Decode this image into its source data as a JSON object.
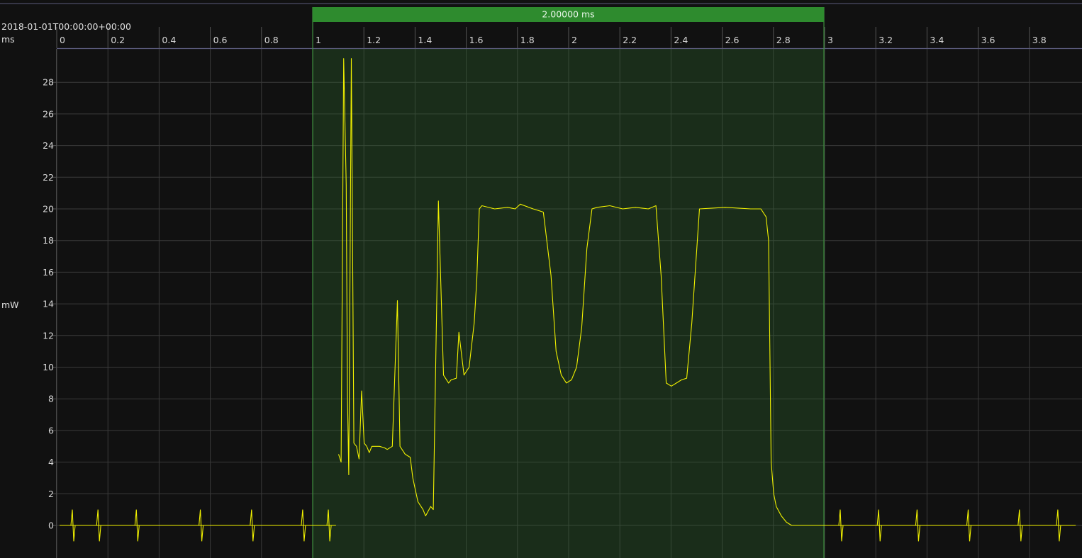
{
  "chart_data": {
    "type": "line",
    "timestamp": "2018-01-01T00:00:00+00:00",
    "xlabel": "ms",
    "ylabel": "mW",
    "xlim": [
      -0.22,
      3.97
    ],
    "ylim": [
      -1.9,
      30.0
    ],
    "x_ticks": [
      0,
      0.2,
      0.4,
      0.6,
      0.8,
      1,
      1.2,
      1.4,
      1.6,
      1.8,
      2,
      2.2,
      2.4,
      2.6,
      2.8,
      3,
      3.2,
      3.4,
      3.6,
      3.8
    ],
    "x_tick_labels": [
      "0",
      "0.2",
      "0.4",
      "0.6",
      "0.8",
      "1",
      "1.2",
      "1.4",
      "1.6",
      "1.8",
      "2",
      "2.2",
      "2.4",
      "2.6",
      "2.8",
      "3",
      "3.2",
      "3.4",
      "3.6",
      "3.8"
    ],
    "y_ticks": [
      0,
      2,
      4,
      6,
      8,
      10,
      12,
      14,
      16,
      18,
      20,
      22,
      24,
      26,
      28
    ],
    "y_tick_labels": [
      "0",
      "2",
      "4",
      "6",
      "8",
      "10",
      "12",
      "14",
      "16",
      "18",
      "20",
      "22",
      "24",
      "26",
      "28"
    ],
    "grid": true,
    "selection": {
      "start": 1.0,
      "end": 3.0,
      "label": "2.00000 ms",
      "color": "#2e8b2e"
    },
    "series": [
      {
        "color": "#f2f200",
        "segments": [
          {
            "x": [
              0.0,
              0.25,
              0.45,
              0.65,
              0.8,
              0.92,
              0.98,
              1.03,
              1.08
            ],
            "y": [
              0,
              0,
              0,
              0,
              0,
              0,
              0,
              0,
              0
            ]
          },
          {
            "x": [
              1.09,
              1.1,
              1.11,
              1.12,
              1.125,
              1.13,
              1.14,
              1.15,
              1.16,
              1.17,
              1.18,
              1.19,
              1.2,
              1.21,
              1.22,
              1.23,
              1.25,
              1.27,
              1.28,
              1.3,
              1.32,
              1.33,
              1.35,
              1.37,
              1.38,
              1.4,
              1.42,
              1.43,
              1.45,
              1.46,
              1.48,
              1.49,
              1.5,
              1.52,
              1.53,
              1.55,
              1.56,
              1.58,
              1.6,
              1.62,
              1.63,
              1.64,
              1.65,
              1.7,
              1.75,
              1.78,
              1.8,
              1.85,
              1.89
            ],
            "y": [
              4.5,
              4.0,
              29.5,
              21.5,
              8.0,
              3.2,
              29.5,
              5.2,
              5.0,
              4.2,
              8.5,
              5.2,
              5.0,
              4.6,
              5.0,
              5.0,
              5.0,
              4.9,
              4.8,
              5.0,
              14.2,
              5.0,
              4.5,
              4.3,
              3.0,
              1.5,
              1.0,
              0.6,
              1.2,
              1.0,
              20.5,
              15.0,
              9.5,
              9.0,
              9.2,
              9.3,
              12.2,
              9.5,
              10.0,
              12.8,
              15.5,
              20.0,
              20.2,
              20.0,
              20.1,
              20.0,
              20.3,
              20.0,
              19.8
            ]
          },
          {
            "x": [
              1.89,
              1.92,
              1.94,
              1.96,
              1.98,
              2.0,
              2.02,
              2.04,
              2.06,
              2.08,
              2.1,
              2.15,
              2.2,
              2.25,
              2.3,
              2.33,
              2.35,
              2.37,
              2.39,
              2.41,
              2.43,
              2.45,
              2.47,
              2.5,
              2.6,
              2.7,
              2.74,
              2.76,
              2.77,
              2.78,
              2.79,
              2.8,
              2.82,
              2.84,
              2.86,
              2.9,
              3.0,
              3.3,
              3.6,
              3.97
            ],
            "y": [
              19.8,
              15.8,
              11.0,
              9.5,
              9.0,
              9.2,
              10.0,
              12.5,
              17.5,
              20.0,
              20.1,
              20.2,
              20.0,
              20.1,
              20.0,
              20.2,
              15.8,
              9.0,
              8.8,
              9.0,
              9.2,
              9.3,
              12.8,
              20.0,
              20.1,
              20.0,
              20.0,
              19.5,
              18.0,
              4.0,
              2.0,
              1.2,
              0.6,
              0.2,
              0.0,
              0.0,
              0.0,
              0.0,
              0.0,
              0.0
            ]
          }
        ]
      }
    ],
    "spikes": [
      {
        "x": [
          0.05,
          0.15,
          0.3,
          0.55,
          0.75,
          0.95,
          1.05
        ],
        "up": 1.0,
        "down": -1.0
      },
      {
        "x": [
          3.05,
          3.2,
          3.35,
          3.55,
          3.75,
          3.9
        ],
        "up": 1.0,
        "down": -1.0
      }
    ]
  }
}
